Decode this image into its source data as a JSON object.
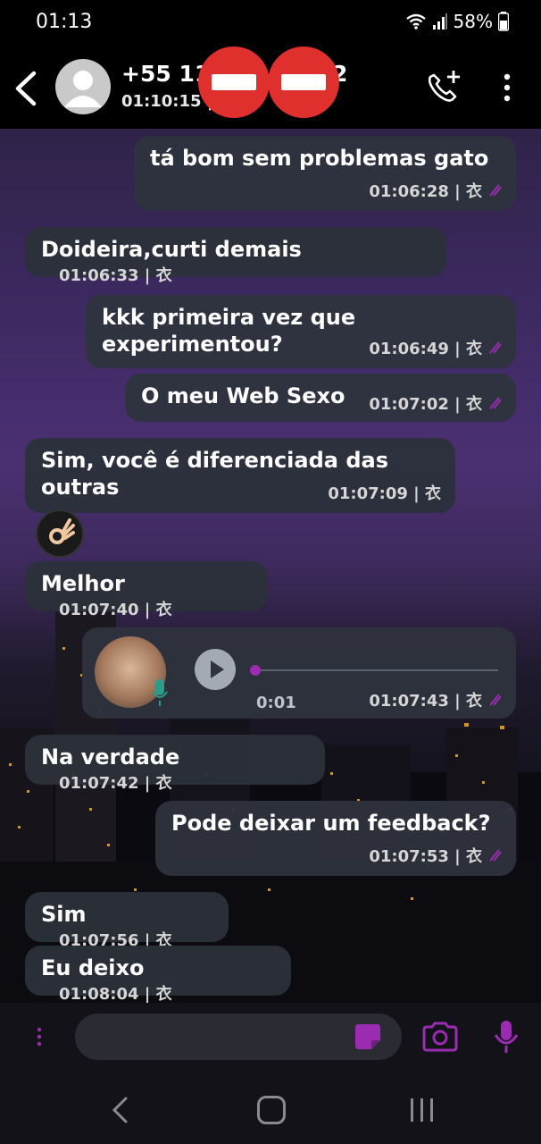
{
  "status": {
    "time": "01:13",
    "battery": "58%"
  },
  "header": {
    "contact_name": "+55 11",
    "contact_name_suffix": "2",
    "subtitle": "01:10:15 |"
  },
  "messages": [
    {
      "text": "tá bom sem problemas gato",
      "time": "01:06:28 | 衣",
      "direction": "out"
    },
    {
      "text": "Doideira,curti demais",
      "time": "01:06:33 | 衣",
      "direction": "in"
    },
    {
      "text": "kkk primeira vez que experimentou?",
      "time": "01:06:49 | 衣",
      "direction": "out"
    },
    {
      "text": "O meu Web Sexo",
      "time": "01:07:02 | 衣",
      "direction": "out"
    },
    {
      "text": "Sim, você é diferenciada das outras",
      "time": "01:07:09 | 衣",
      "direction": "in"
    },
    {
      "text": "Melhor",
      "time": "01:07:40 | 衣",
      "direction": "in"
    },
    {
      "text": "Na verdade",
      "time": "01:07:42 | 衣",
      "direction": "in"
    },
    {
      "text": "Pode deixar um feedback?",
      "time": "01:07:53 | 衣",
      "direction": "out"
    },
    {
      "text": "Sim",
      "time": "01:07:56 | 衣",
      "direction": "in"
    },
    {
      "text": "Eu deixo",
      "time": "01:08:04 | 衣",
      "direction": "in"
    }
  ],
  "voice_message": {
    "duration": "0:01",
    "time": "01:07:43 | 衣",
    "progress": 0.0
  },
  "colors": {
    "accent": "#9b2bb0",
    "bubble": "#2e333d",
    "redaction": "#e0302e"
  },
  "icons": [
    "back-icon",
    "avatar-icon",
    "call-add-icon",
    "more-vert-icon",
    "play-icon",
    "mic-icon",
    "camera-icon",
    "sticker-icon",
    "more-icon"
  ]
}
